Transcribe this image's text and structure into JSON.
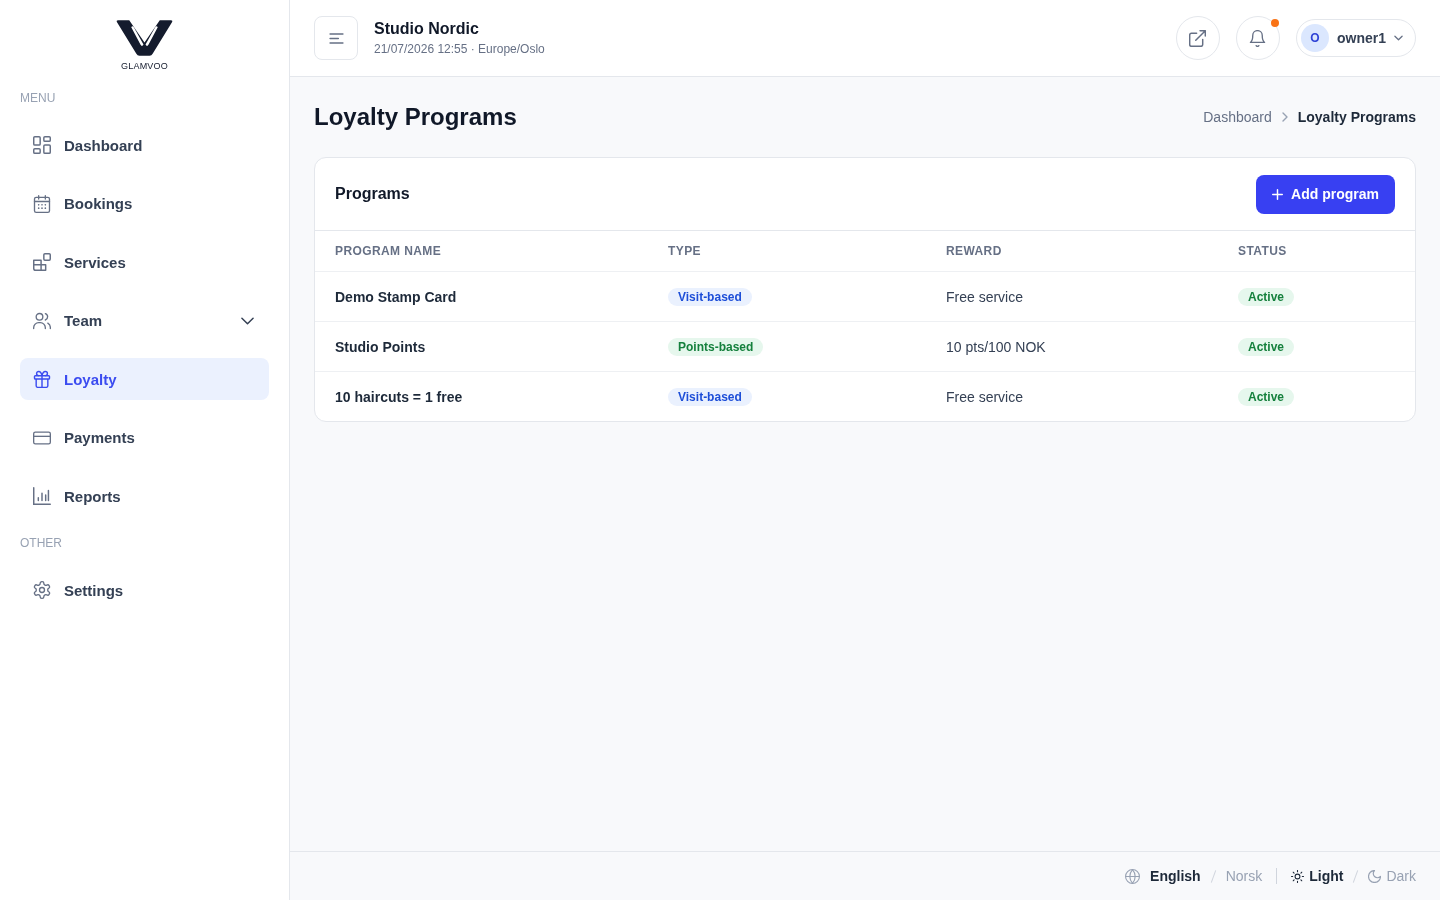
{
  "brand": {
    "name": "GLAMVOO"
  },
  "sidebar": {
    "sections": [
      {
        "title": "MENU",
        "items": [
          {
            "label": "Dashboard",
            "kind": "link",
            "selected": false
          },
          {
            "label": "Bookings",
            "kind": "link",
            "selected": false
          },
          {
            "label": "Services",
            "kind": "link",
            "selected": false
          },
          {
            "label": "Team",
            "kind": "group",
            "expanded": false,
            "selected": false
          },
          {
            "label": "Loyalty",
            "kind": "link",
            "selected": true
          },
          {
            "label": "Payments",
            "kind": "link",
            "selected": false
          },
          {
            "label": "Reports",
            "kind": "link",
            "selected": false
          }
        ]
      },
      {
        "title": "OTHER",
        "items": [
          {
            "label": "Settings",
            "kind": "link",
            "selected": false
          }
        ]
      }
    ]
  },
  "header": {
    "title": "Studio Nordic",
    "subtitle": "21/07/2026 12:55 · Europe/Oslo",
    "notifications": {
      "unread": true
    },
    "user": {
      "initial": "O",
      "name": "owner1"
    }
  },
  "page": {
    "title": "Loyalty Programs",
    "breadcrumb": [
      "Dashboard",
      "Loyalty Programs"
    ]
  },
  "programs": {
    "title": "Programs",
    "add_button": "Add program",
    "columns": [
      "PROGRAM NAME",
      "TYPE",
      "REWARD",
      "STATUS"
    ],
    "rows": [
      {
        "name": "Demo Stamp Card",
        "type": {
          "label": "Visit-based",
          "kind": "visit"
        },
        "reward": "Free service",
        "status": {
          "label": "Active",
          "kind": "active"
        }
      },
      {
        "name": "Studio Points",
        "type": {
          "label": "Points-based",
          "kind": "points"
        },
        "reward": "10 pts/100 NOK",
        "status": {
          "label": "Active",
          "kind": "active"
        }
      },
      {
        "name": "10 haircuts = 1 free",
        "type": {
          "label": "Visit-based",
          "kind": "visit"
        },
        "reward": "Free service",
        "status": {
          "label": "Active",
          "kind": "active"
        }
      }
    ]
  },
  "footer": {
    "languages": [
      {
        "label": "English",
        "selected": true
      },
      {
        "label": "Norsk",
        "selected": false
      }
    ],
    "themes": [
      {
        "label": "Light",
        "kind": "light",
        "selected": true
      },
      {
        "label": "Dark",
        "kind": "dark",
        "selected": false
      }
    ]
  }
}
